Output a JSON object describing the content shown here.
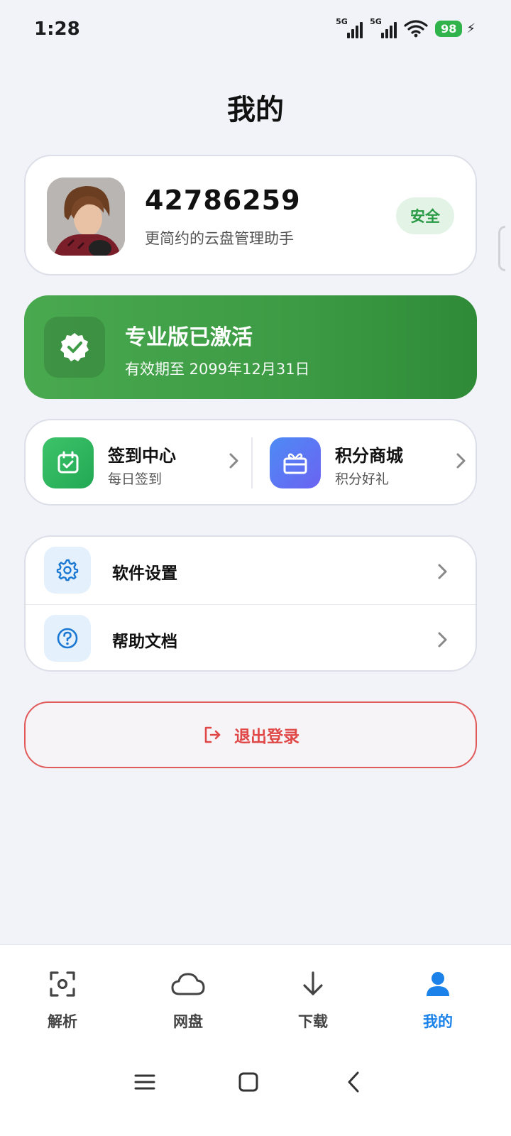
{
  "status_bar": {
    "time": "1:28",
    "network_1": "5G",
    "network_2": "5G",
    "battery": "98"
  },
  "page": {
    "title": "我的"
  },
  "profile": {
    "user_id": "42786259",
    "slogan": "更简约的云盘管理助手",
    "badge": "安全"
  },
  "pro": {
    "title": "专业版已激活",
    "expiry": "有效期至 2099年12月31日",
    "accent": "#3c9b44"
  },
  "quick": {
    "checkin": {
      "title": "签到中心",
      "sub": "每日签到"
    },
    "mall": {
      "title": "积分商城",
      "sub": "积分好礼"
    }
  },
  "menu": {
    "settings": {
      "label": "软件设置",
      "icon": "gear-icon"
    },
    "help": {
      "label": "帮助文档",
      "icon": "question-icon"
    }
  },
  "logout": {
    "label": "退出登录",
    "color": "#e04848"
  },
  "bottom_nav": {
    "items": [
      {
        "label": "解析",
        "icon": "scan-icon"
      },
      {
        "label": "网盘",
        "icon": "cloud-icon"
      },
      {
        "label": "下载",
        "icon": "download-arrow-icon"
      },
      {
        "label": "我的",
        "icon": "person-icon",
        "active": true
      }
    ],
    "active_color": "#1a82e8"
  }
}
